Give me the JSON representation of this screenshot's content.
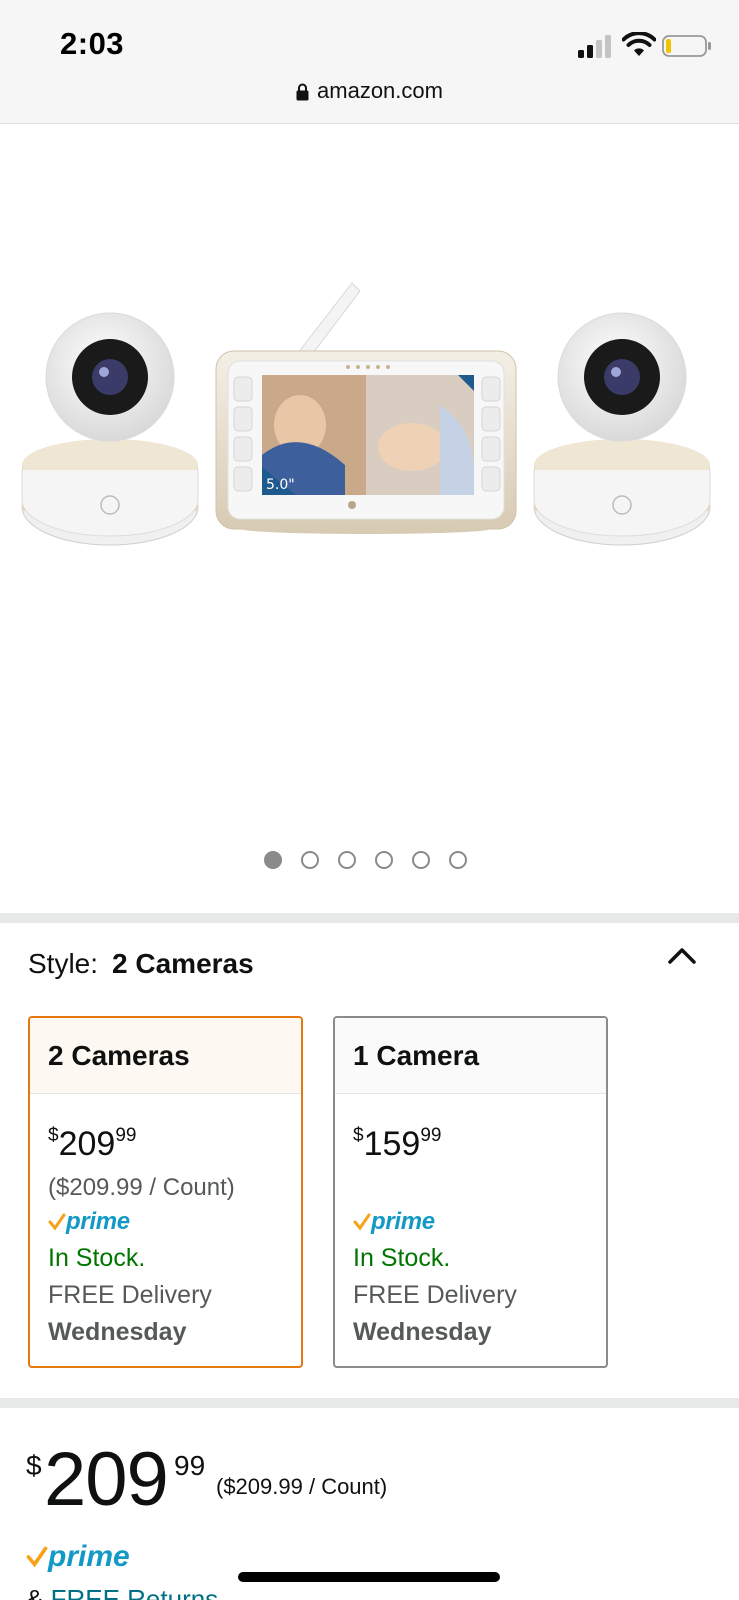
{
  "status_bar": {
    "time": "2:03"
  },
  "browser": {
    "url": "amazon.com"
  },
  "carousel": {
    "total": 6,
    "active_index": 0,
    "screen_size_label": "5.0\""
  },
  "style_selector": {
    "label": "Style:",
    "selected": "2 Cameras",
    "options": [
      {
        "name": "2 Cameras",
        "price_symbol": "$",
        "price_whole": "209",
        "price_fraction": "99",
        "unit_price": "($209.99 / Count)",
        "prime": "prime",
        "stock": "In Stock.",
        "delivery": "FREE Delivery",
        "day": "Wednesday"
      },
      {
        "name": "1 Camera",
        "price_symbol": "$",
        "price_whole": "159",
        "price_fraction": "99",
        "unit_price": "",
        "prime": "prime",
        "stock": "In Stock.",
        "delivery": "FREE Delivery",
        "day": "Wednesday"
      }
    ]
  },
  "buybox": {
    "price_symbol": "$",
    "price_whole": "209",
    "price_fraction": "99",
    "unit_price": "($209.99 / Count)",
    "prime": "prime",
    "returns_prefix": "&",
    "returns_link": "FREE Returns"
  },
  "colors": {
    "accent": "#e47911",
    "prime_blue": "#1399c6",
    "in_stock": "#007600",
    "link": "#007185"
  }
}
